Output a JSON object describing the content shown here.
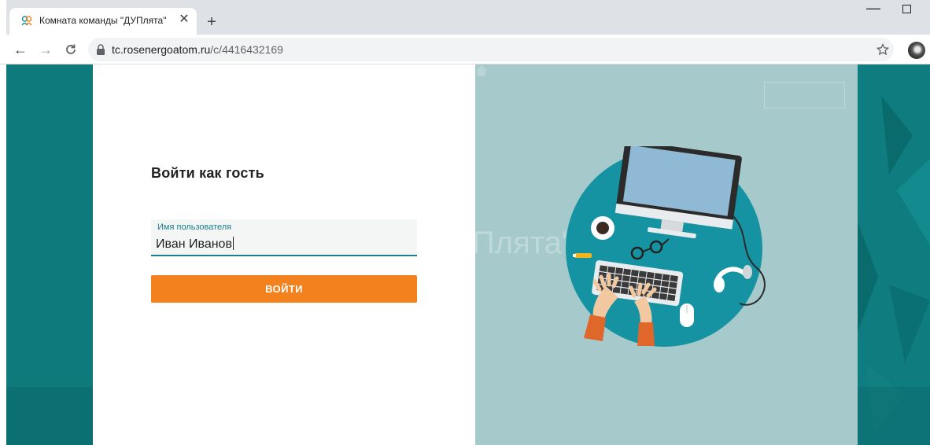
{
  "browser": {
    "tab_title": "Комната команды \"ДУПлята\"",
    "tab_close": "✕",
    "new_tab": "+",
    "url_host": "tc.rosenergoatom.ru",
    "url_path": "/c/4416432169",
    "icons": [
      "favicon-icon",
      "close-icon",
      "plus-icon",
      "minimize-icon",
      "maximize-icon",
      "back-arrow-icon",
      "forward-arrow-icon",
      "reload-icon",
      "lock-icon",
      "star-icon",
      "avatar"
    ]
  },
  "login": {
    "title": "Войти как гость",
    "username_label": "Имя пользователя",
    "username_value": "Иван Иванов",
    "submit_label": "ВОЙТИ"
  },
  "background": {
    "room_title_fragment": "Плята\""
  },
  "colors": {
    "teal_dark": "#0e7a7c",
    "teal_light": "#a6cacb",
    "accent_orange": "#f3811d",
    "field_underline": "#1b7f8c",
    "illustration_circle": "#1693a3"
  }
}
